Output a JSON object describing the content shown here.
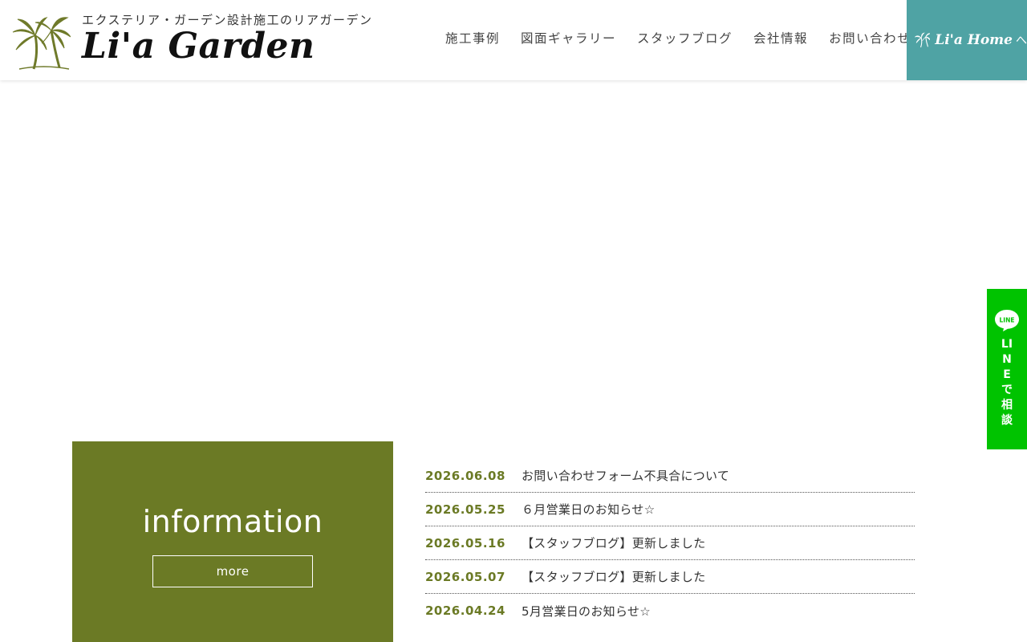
{
  "header": {
    "tagline": "エクステリア・ガーデン設計施工のリアガーデン",
    "logo_text": "Li'a Garden",
    "nav": [
      {
        "label": "施工事例"
      },
      {
        "label": "図面ギャラリー"
      },
      {
        "label": "スタッフブログ"
      },
      {
        "label": "会社情報"
      },
      {
        "label": "お問い合わせ"
      }
    ],
    "home_button": {
      "label": "Li'a Home",
      "chevron": "へ"
    }
  },
  "info": {
    "title": "information",
    "more_label": "more",
    "items": [
      {
        "date": "2026.06.08",
        "title": "お問い合わせフォーム不具合について"
      },
      {
        "date": "2026.05.25",
        "title": "６月営業日のお知らせ☆"
      },
      {
        "date": "2026.05.16",
        "title": "【スタッフブログ】更新しました "
      },
      {
        "date": "2026.05.07",
        "title": "【スタッフブログ】更新しました "
      },
      {
        "date": "2026.04.24",
        "title": "5月営業日のお知らせ☆"
      }
    ]
  },
  "line_button": {
    "bubble_text": "LINE",
    "label": "LINEで相談"
  },
  "colors": {
    "accent_olive": "#6b7a25",
    "home_teal": "#4fa3a4",
    "line_green": "#00c300"
  }
}
